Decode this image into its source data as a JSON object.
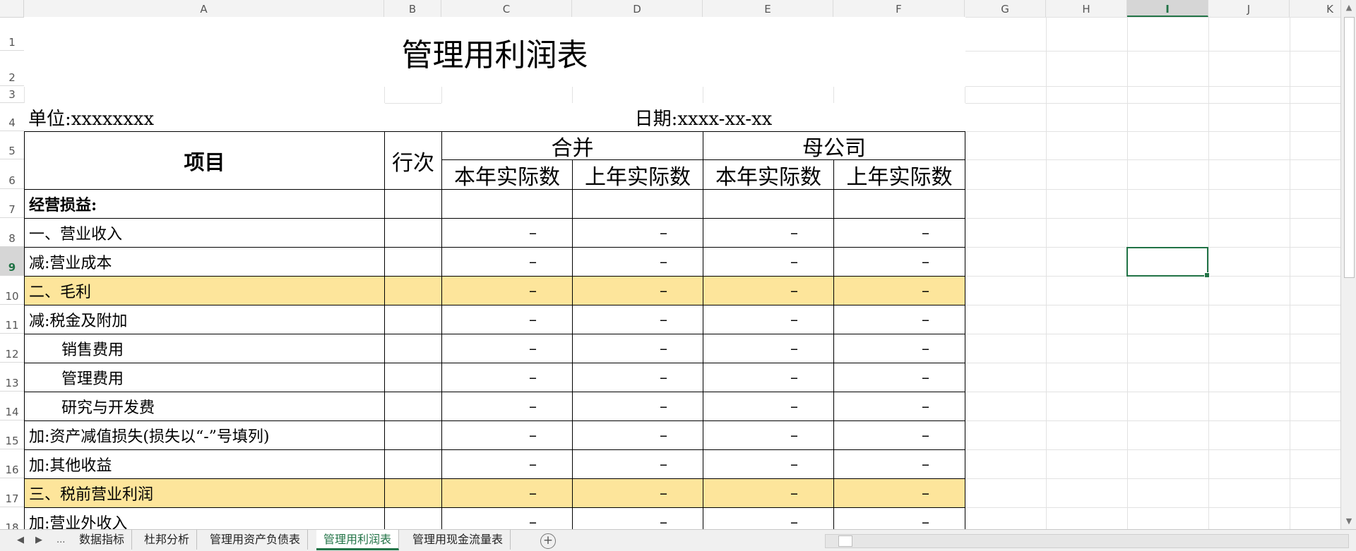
{
  "columns": [
    {
      "label": "A",
      "w": 510
    },
    {
      "label": "B",
      "w": 81
    },
    {
      "label": "C",
      "w": 185
    },
    {
      "label": "D",
      "w": 185
    },
    {
      "label": "E",
      "w": 185
    },
    {
      "label": "F",
      "w": 186
    },
    {
      "label": "G",
      "w": 115
    },
    {
      "label": "H",
      "w": 115
    },
    {
      "label": "I",
      "w": 115
    },
    {
      "label": "J",
      "w": 115
    },
    {
      "label": "K",
      "w": 115
    }
  ],
  "active_column": "I",
  "active_row": "9",
  "rows": [
    "1",
    "2",
    "3",
    "4",
    "5",
    "6",
    "7",
    "8",
    "9",
    "10",
    "11",
    "12",
    "13",
    "14",
    "15",
    "16",
    "17",
    "18"
  ],
  "title": "管理用利润表",
  "unit_label": "单位:xxxxxxxx",
  "date_label": "日期:xxxx-xx-xx",
  "headers": {
    "item": "项目",
    "line_no": "行次",
    "consolidated": "合并",
    "parent": "母公司",
    "current_year": "本年实际数",
    "prior_year": "上年实际数"
  },
  "table_rows": [
    {
      "label": "经营损益:",
      "style": "bold",
      "values": [
        "",
        "",
        "",
        ""
      ]
    },
    {
      "label": "一、营业收入",
      "style": "",
      "values": [
        "–",
        "–",
        "–",
        "–"
      ]
    },
    {
      "label": "减:营业成本",
      "style": "",
      "values": [
        "–",
        "–",
        "–",
        "–"
      ]
    },
    {
      "label": "二、毛利",
      "style": "yellow",
      "values": [
        "–",
        "–",
        "–",
        "–"
      ]
    },
    {
      "label": "减:税金及附加",
      "style": "",
      "values": [
        "–",
        "–",
        "–",
        "–"
      ]
    },
    {
      "label": "销售费用",
      "style": "indent",
      "values": [
        "–",
        "–",
        "–",
        "–"
      ]
    },
    {
      "label": "管理费用",
      "style": "indent",
      "values": [
        "–",
        "–",
        "–",
        "–"
      ]
    },
    {
      "label": "研究与开发费",
      "style": "indent",
      "values": [
        "–",
        "–",
        "–",
        "–"
      ]
    },
    {
      "label": "加:资产减值损失(损失以“-”号填列)",
      "style": "",
      "values": [
        "–",
        "–",
        "–",
        "–"
      ]
    },
    {
      "label": "加:其他收益",
      "style": "",
      "values": [
        "–",
        "–",
        "–",
        "–"
      ]
    },
    {
      "label": "三、税前营业利润",
      "style": "yellow",
      "values": [
        "–",
        "–",
        "–",
        "–"
      ]
    },
    {
      "label": "加:营业外收入",
      "style": "",
      "values": [
        "–",
        "–",
        "–",
        "–"
      ]
    }
  ],
  "sheet_tabs": [
    {
      "label": "数据指标",
      "active": false
    },
    {
      "label": "杜邦分析",
      "active": false
    },
    {
      "label": "管理用资产负债表",
      "active": false
    },
    {
      "label": "管理用利润表",
      "active": true
    },
    {
      "label": "管理用现金流量表",
      "active": false
    }
  ],
  "nav": {
    "prev": "◀",
    "next": "▶",
    "more": "..."
  },
  "add_sheet": "+",
  "colors": {
    "accent": "#217346",
    "highlight": "#fde59b"
  }
}
